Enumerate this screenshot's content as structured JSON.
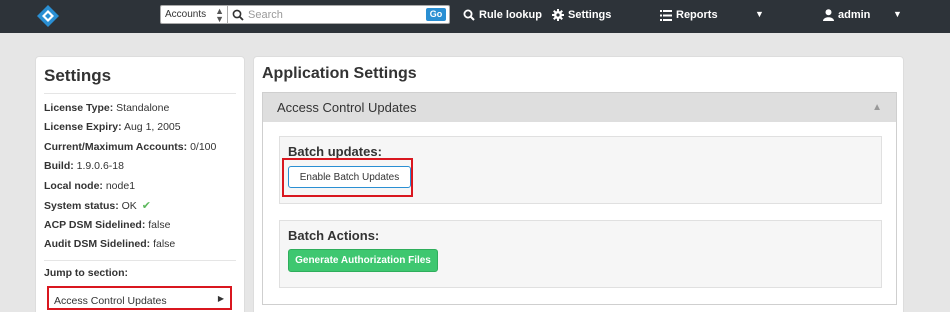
{
  "colors": {
    "nav_bg": "#2d3339",
    "accent": "#2a8fd3",
    "success": "#3ec770",
    "highlight": "#d9171f"
  },
  "topnav": {
    "account_select": "Accounts",
    "search_placeholder": "Search",
    "go_label": "Go",
    "rule_lookup": "Rule lookup",
    "settings": "Settings",
    "reports": "Reports",
    "user": "admin"
  },
  "sidebar": {
    "title": "Settings",
    "info": [
      {
        "label": "License Type:",
        "value": "Standalone"
      },
      {
        "label": "License Expiry:",
        "value": "Aug 1, 2005"
      },
      {
        "label": "Current/Maximum Accounts:",
        "value": "0/100"
      },
      {
        "label": "Build:",
        "value": "1.9.0.6-18"
      },
      {
        "label": "Local node:",
        "value": "node1"
      },
      {
        "label": "System status:",
        "value": "OK"
      },
      {
        "label": "ACP DSM Sidelined:",
        "value": "false"
      },
      {
        "label": "Audit DSM Sidelined:",
        "value": "false"
      }
    ],
    "jump_label": "Jump to section:",
    "jump_link": "Access Control Updates"
  },
  "main": {
    "title": "Application Settings",
    "section_title": "Access Control Updates",
    "batch_updates_title": "Batch updates:",
    "enable_batch_button": "Enable Batch Updates",
    "batch_actions_title": "Batch Actions:",
    "generate_button": "Generate Authorization Files"
  }
}
